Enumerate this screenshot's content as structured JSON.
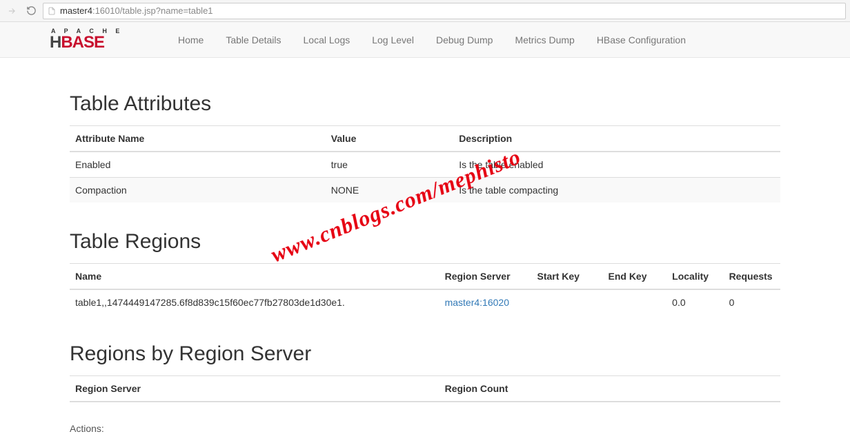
{
  "browser": {
    "url_host": "master4",
    "url_rest": ":16010/table.jsp?name=table1"
  },
  "nav": {
    "items": [
      {
        "label": "Home"
      },
      {
        "label": "Table Details"
      },
      {
        "label": "Local Logs"
      },
      {
        "label": "Log Level"
      },
      {
        "label": "Debug Dump"
      },
      {
        "label": "Metrics Dump"
      },
      {
        "label": "HBase Configuration"
      }
    ],
    "logo_top": "A P A C H E",
    "logo_h": "H",
    "logo_base": "BASE"
  },
  "sections": {
    "attributes": {
      "title": "Table Attributes",
      "headers": {
        "name": "Attribute Name",
        "value": "Value",
        "desc": "Description"
      },
      "rows": [
        {
          "name": "Enabled",
          "value": "true",
          "desc": "Is the table enabled"
        },
        {
          "name": "Compaction",
          "value": "NONE",
          "desc": "Is the table compacting"
        }
      ]
    },
    "regions": {
      "title": "Table Regions",
      "headers": {
        "name": "Name",
        "server": "Region Server",
        "start": "Start Key",
        "end": "End Key",
        "locality": "Locality",
        "requests": "Requests"
      },
      "rows": [
        {
          "name": "table1,,1474449147285.6f8d839c15f60ec77fb27803de1d30e1.",
          "server": "master4:16020",
          "start": "",
          "end": "",
          "locality": "0.0",
          "requests": "0"
        }
      ]
    },
    "by_server": {
      "title": "Regions by Region Server",
      "headers": {
        "server": "Region Server",
        "count": "Region Count"
      }
    },
    "actions_label": "Actions:"
  },
  "watermark": "www.cnblogs.com/mephisto"
}
